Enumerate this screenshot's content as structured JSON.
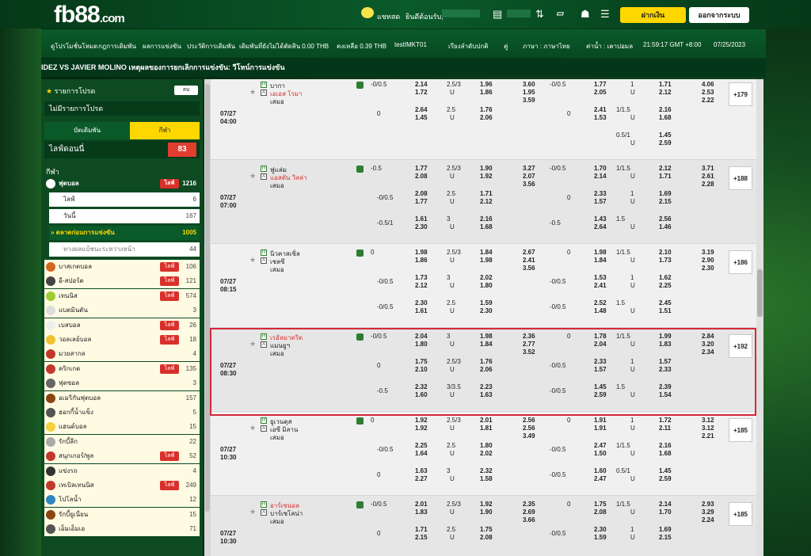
{
  "header": {
    "logo_main": "fb88",
    "logo_sub": ".com",
    "chat_label": "แชทสด",
    "welcome": "ยินดีต้อนรับ,",
    "deposit": "ฝากเงิน",
    "logout": "ออกจากระบบ"
  },
  "nav": {
    "items": [
      "ดูโปรโมชั่นโหมด",
      "กฎการเดิมพัน",
      "ผลการแข่งขัน",
      "ประวัติการเดิมพัน",
      "เดิมพันที่ยังไม่ได้ตัดสิน 0.00 THB",
      "คงเหลือ 0.39 THB",
      "testIMKT01",
      "เรียงลำดับปกติ",
      "คู่",
      "ภาษา : ภาษาไทย",
      "ค่าน้ำ : เคาปอมล",
      "21:59:17 GMT +8:00",
      "07/25/2023"
    ]
  },
  "title": "IDEZ VS JAVIER MOLINO  เหตุผลของการยกเลิกการแข่งขัน: วีโหน์การแข่งขัน",
  "sidebar": {
    "promo_title": "รายการโปรด",
    "promo_btn": "ลบ",
    "no_promo": "ไม่มีรายการโปรด",
    "tab_bet": "บัตเดิมพัน",
    "tab_sport": "กีฬา",
    "live": "ไลฟ์ดอนนี่",
    "live_count": "83",
    "sport_head": "กีฬา",
    "football": "ฟุตบอล",
    "football_live": "ไลฟ์",
    "football_count": "1216",
    "sub": [
      {
        "label": "ไลฟ์",
        "count": "6"
      },
      {
        "label": "วันนี้",
        "count": "167"
      },
      {
        "label": "» ตลาดก่อนการแข่งขัน",
        "count": "1005"
      },
      {
        "label": "ทางผลแบ้ชนะระหว่างหน้า",
        "count": "44"
      }
    ],
    "sports": [
      {
        "label": "บาสเกตบอล",
        "count": "106",
        "live": true,
        "color": "#d2691e"
      },
      {
        "label": "อี-สปอร์ต",
        "count": "121",
        "live": true,
        "color": "#444"
      },
      {
        "label": "เทนนิส",
        "count": "574",
        "live": true,
        "color": "#9acd32"
      },
      {
        "label": "แบดมินตัน",
        "count": "3",
        "live": false,
        "color": "#ddd"
      },
      {
        "label": "เบสบอล",
        "count": "26",
        "live": true,
        "color": "#eee"
      },
      {
        "label": "วอลเลย์บอล",
        "count": "18",
        "live": true,
        "color": "#f0c030"
      },
      {
        "label": "มวยสากล",
        "count": "4",
        "live": false,
        "color": "#c0392b"
      },
      {
        "label": "คริกเกต",
        "count": "135",
        "live": true,
        "color": "#c0392b"
      },
      {
        "label": "ฟุตซอล",
        "count": "3",
        "live": false,
        "color": "#666"
      },
      {
        "label": "อเมริกันฟุตบอล",
        "count": "157",
        "live": false,
        "color": "#8b4513"
      },
      {
        "label": "ฮอกกี้น้ำแข็ง",
        "count": "5",
        "live": false,
        "color": "#555"
      },
      {
        "label": "แฮนด์บอล",
        "count": "15",
        "live": false,
        "color": "#f4d03f"
      },
      {
        "label": "รักบี้ลีก",
        "count": "22",
        "live": false,
        "color": "#aaa"
      },
      {
        "label": "สนุกเกอร์/พูล",
        "count": "52",
        "live": true,
        "color": "#c0392b"
      },
      {
        "label": "แข่งรถ",
        "count": "4",
        "live": false,
        "color": "#333"
      },
      {
        "label": "เทเบิลเทนนิส",
        "count": "249",
        "live": true,
        "color": "#c0392b"
      },
      {
        "label": "โปโลน้ำ",
        "count": "12",
        "live": false,
        "color": "#2e86c1"
      },
      {
        "label": "รักบี้ยูเนี่ยน",
        "count": "15",
        "live": false,
        "color": "#8b4513"
      },
      {
        "label": "เอ็มเอ็มเอ",
        "count": "71",
        "live": false,
        "color": "#555"
      }
    ]
  },
  "matches": [
    {
      "date": "07/27",
      "time": "04:00",
      "home": "บากา",
      "away": "เอเอส โรมา",
      "draw": "เสมอ",
      "home_red": false,
      "away_red": true,
      "more": "+179",
      "rows": [
        {
          "h1": "-0/0.5",
          "o1": "2.14|1.72",
          "ou1": "2.5/3|U",
          "p1": "1.96|1.86",
          "x1": "3.60|1.95|3.59",
          "h2": "-0/0.5",
          "o2": "1.77|2.05",
          "ou2": "1|U",
          "p2": "1.71|2.12",
          "x2": "4.06|2.53|2.22"
        },
        {
          "h1": "0",
          "o1": "2.64|1.45",
          "ou1": "2.5|U",
          "p1": "1.76|2.06",
          "x1": "",
          "h2": "0",
          "o2": "2.41|1.53",
          "ou2": "1/1.5|U",
          "p2": "2.16|1.68",
          "x2": ""
        },
        {
          "h1": "",
          "o1": "|",
          "ou1": "|",
          "p1": "|",
          "x1": "",
          "h2": "",
          "o2": "|",
          "ou2": "0.5/1|U",
          "p2": "1.45|2.59",
          "x2": ""
        }
      ]
    },
    {
      "date": "07/27",
      "time": "07:00",
      "home": "ฟูแล่ม",
      "away": "แอสตัน วิลล่า",
      "draw": "เสมอ",
      "home_red": false,
      "away_red": true,
      "more": "+188",
      "rows": [
        {
          "h1": "-0.5",
          "o1": "1.77|2.08",
          "ou1": "2.5/3|U",
          "p1": "1.90|1.92",
          "x1": "3.27|2.07|3.56",
          "h2": "-0/0.5",
          "o2": "1.70|2.14",
          "ou2": "1/1.5|U",
          "p2": "2.12|1.71",
          "x2": "3.71|2.61|2.28"
        },
        {
          "h1": "-0/0.5",
          "o1": "2.08|1.77",
          "ou1": "2.5|U",
          "p1": "1.71|2.12",
          "x1": "",
          "h2": "0",
          "o2": "2.33|1.57",
          "ou2": "1|U",
          "p2": "1.69|2.15",
          "x2": ""
        },
        {
          "h1": "-0.5/1",
          "o1": "1.61|2.30",
          "ou1": "3|U",
          "p1": "2.16|1.68",
          "x1": "",
          "h2": "-0.5",
          "o2": "1.43|2.64",
          "ou2": "1.5|U",
          "p2": "2.56|1.46",
          "x2": ""
        }
      ]
    },
    {
      "date": "07/27",
      "time": "08:15",
      "home": "นิวคาสเซิ่ล",
      "away": "เชลซี",
      "draw": "เสมอ",
      "home_red": false,
      "away_red": false,
      "more": "+186",
      "rows": [
        {
          "h1": "0",
          "o1": "1.98|1.86",
          "ou1": "2.5/3|U",
          "p1": "1.84|1.98",
          "x1": "2.67|2.41|3.56",
          "h2": "0",
          "o2": "1.98|1.84",
          "ou2": "1/1.5|U",
          "p2": "2.10|1.73",
          "x2": "3.19|2.90|2.30"
        },
        {
          "h1": "-0/0.5",
          "o1": "1.73|2.12",
          "ou1": "3|U",
          "p1": "2.02|1.80",
          "x1": "",
          "h2": "-0/0.5",
          "o2": "1.53|2.41",
          "ou2": "1|U",
          "p2": "1.62|2.25",
          "x2": ""
        },
        {
          "h1": "-0/0.5",
          "o1": "2.30|1.61",
          "ou1": "2.5|U",
          "p1": "1.59|2.30",
          "x1": "",
          "h2": "-0/0.5",
          "o2": "2.52|1.48",
          "ou2": "1.5|U",
          "p2": "2.45|1.51",
          "x2": ""
        }
      ]
    },
    {
      "date": "07/27",
      "time": "08:30",
      "home": "เรอัลมาดริด",
      "away": "แมนยูฯ",
      "draw": "เสมอ",
      "home_red": true,
      "away_red": false,
      "more": "+192",
      "rows": [
        {
          "h1": "-0/0.5",
          "o1": "2.04|1.80",
          "ou1": "3|U",
          "p1": "1.98|1.84",
          "x1": "2.36|2.77|3.52",
          "h2": "0",
          "o2": "1.78|2.04",
          "ou2": "1/1.5|U",
          "p2": "1.99|1.83",
          "x2": "2.84|3.20|2.34"
        },
        {
          "h1": "0",
          "o1": "1.75|2.10",
          "ou1": "2.5/3|U",
          "p1": "1.76|2.06",
          "x1": "",
          "h2": "-0/0.5",
          "o2": "2.33|1.57",
          "ou2": "1|U",
          "p2": "1.57|2.33",
          "x2": ""
        },
        {
          "h1": "-0.5",
          "o1": "2.32|1.60",
          "ou1": "3/3.5|U",
          "p1": "2.23|1.63",
          "x1": "",
          "h2": "-0/0.5",
          "o2": "1.45|2.59",
          "ou2": "1.5|U",
          "p2": "2.39|1.54",
          "x2": ""
        }
      ]
    },
    {
      "date": "07/27",
      "time": "10:30",
      "home": "ยูเวนตุส",
      "away": "เอซี มิลาน",
      "draw": "เสมอ",
      "home_red": false,
      "away_red": false,
      "more": "+185",
      "rows": [
        {
          "h1": "0",
          "o1": "1.92|1.92",
          "ou1": "2.5/3|U",
          "p1": "2.01|1.81",
          "x1": "2.56|2.56|3.49",
          "h2": "0",
          "o2": "1.91|1.91",
          "ou2": "1|U",
          "p2": "1.72|2.11",
          "x2": "3.12|3.12|2.21"
        },
        {
          "h1": "-0/0.5",
          "o1": "2.25|1.64",
          "ou1": "2.5|U",
          "p1": "1.80|2.02",
          "x1": "",
          "h2": "-0/0.5",
          "o2": "2.47|1.50",
          "ou2": "1/1.5|U",
          "p2": "2.16|1.68",
          "x2": ""
        },
        {
          "h1": "0",
          "o1": "1.63|2.27",
          "ou1": "3|U",
          "p1": "2.32|1.58",
          "x1": "",
          "h2": "-0/0.5",
          "o2": "1.60|2.47",
          "ou2": "0.5/1|U",
          "p2": "1.45|2.59",
          "x2": ""
        }
      ]
    },
    {
      "date": "07/27",
      "time": "10:30",
      "home": "อาร์เซนอล",
      "away": "บาร์เซโลน่า",
      "draw": "เสมอ",
      "home_red": true,
      "away_red": false,
      "more": "+185",
      "rows": [
        {
          "h1": "-0/0.5",
          "o1": "2.01|1.83",
          "ou1": "2.5/3|U",
          "p1": "1.92|1.90",
          "x1": "2.35|2.69|3.66",
          "h2": "0",
          "o2": "1.75|2.08",
          "ou2": "1/1.5|U",
          "p2": "2.14|1.70",
          "x2": "2.93|3.29|2.24"
        },
        {
          "h1": "0",
          "o1": "1.71|2.15",
          "ou1": "2.5|U",
          "p1": "1.75|2.08",
          "x1": "",
          "h2": "-0/0.5",
          "o2": "2.30|1.59",
          "ou2": "1|U",
          "p2": "1.69|2.15",
          "x2": ""
        }
      ]
    }
  ]
}
